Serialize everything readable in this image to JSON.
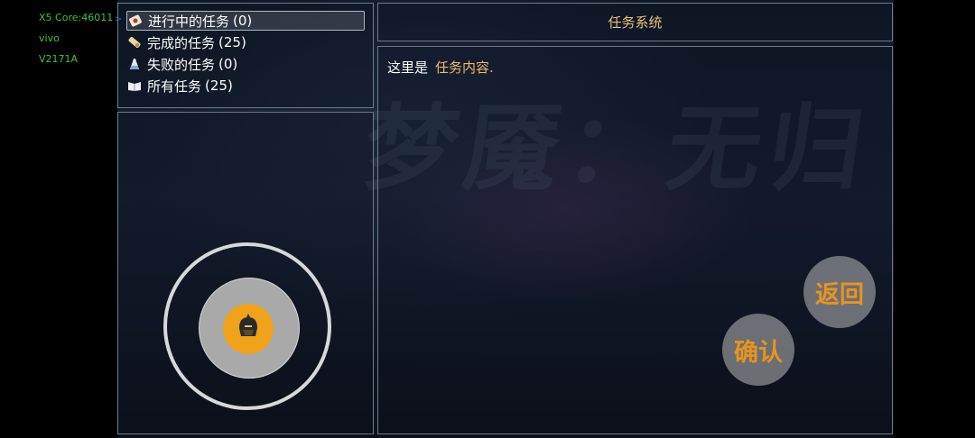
{
  "debug": {
    "line1": "X5  Core:46011",
    "line2": "vivo",
    "line3": "V2171A",
    "arrow": ">"
  },
  "watermark": "梦魇：无归",
  "header": {
    "title": "任务系统"
  },
  "task_tabs": [
    {
      "label": "进行中的任务",
      "count": "(0)",
      "icon": "scroll-seal-icon",
      "selected": true
    },
    {
      "label": "完成的任务",
      "count": "(25)",
      "icon": "scroll-icon",
      "selected": false
    },
    {
      "label": "失败的任务",
      "count": "(0)",
      "icon": "flask-icon",
      "selected": false
    },
    {
      "label": "所有任务",
      "count": "(25)",
      "icon": "open-book-icon",
      "selected": false
    }
  ],
  "content": {
    "prefix": "这里是",
    "highlight": "任务内容."
  },
  "buttons": {
    "back": "返回",
    "confirm": "确认"
  },
  "joystick": {
    "icon": "helmet-icon"
  },
  "colors": {
    "accent_orange": "#e7941f",
    "title_gold": "#e8c27a",
    "debug_green": "#3ec43e"
  }
}
